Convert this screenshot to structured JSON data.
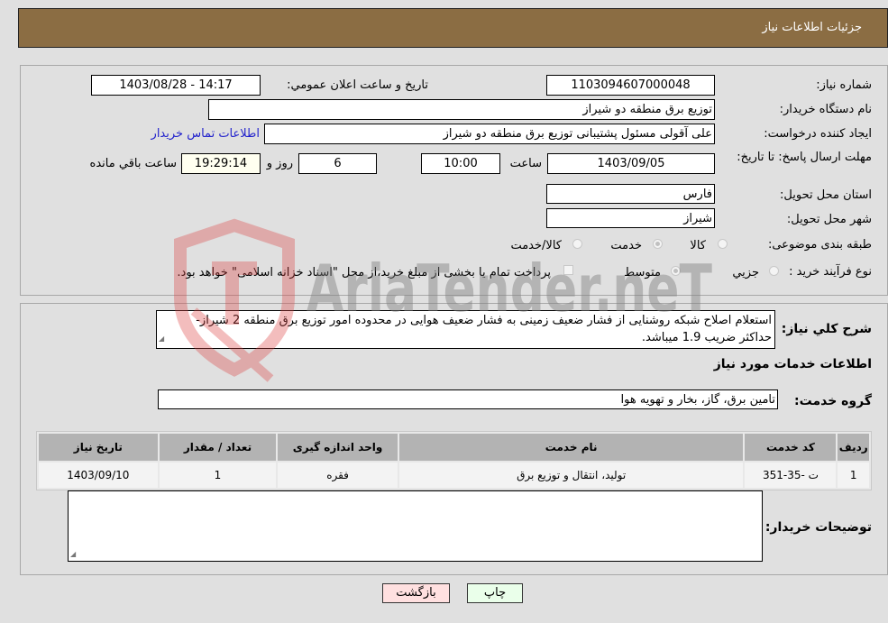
{
  "header": {
    "title": "جزئیات اطلاعات نیاز"
  },
  "fields": {
    "need_number_label": "شماره نیاز:",
    "need_number": "1103094607000048",
    "announce_label": "تاریخ و ساعت اعلان عمومي:",
    "announce_value": "1403/08/28 - 14:17",
    "buyer_org_label": "نام دستگاه خریدار:",
    "buyer_org": "توزیع برق منطقه دو شیراز",
    "creator_label": "ایجاد کننده درخواست:",
    "creator": "علی آقولی مسئول پشتیبانی  توزیع برق منطقه دو شیراز",
    "contact_link": "اطلاعات تماس خریدار",
    "deadline_label": "مهلت ارسال پاسخ: تا تاریخ:",
    "deadline_date": "1403/09/05",
    "time_label": "ساعت",
    "deadline_time": "10:00",
    "days_value": "6",
    "days_label": "روز و",
    "remaining_time": "19:29:14",
    "remaining_label": "ساعت باقي مانده",
    "province_label": "استان محل تحویل:",
    "province": "فارس",
    "city_label": "شهر محل تحویل:",
    "city": "شیراز",
    "category_label": "طبقه بندی موضوعی:",
    "category_options": [
      {
        "label": "کالا",
        "selected": false
      },
      {
        "label": "خدمت",
        "selected": true
      },
      {
        "label": "کالا/خدمت",
        "selected": false
      }
    ],
    "process_label": "نوع فرآیند خرید :",
    "process_options": [
      {
        "label": "جزيي",
        "selected": false
      },
      {
        "label": "متوسط",
        "selected": true
      }
    ],
    "treasury_note": "پرداخت تمام یا بخشی از مبلغ خرید،از محل \"اسناد خزانه اسلامی\" خواهد بود."
  },
  "description": {
    "label": "شرح كلي نياز:",
    "text": "استعلام اصلاح شبکه روشنایی از فشار ضعیف زمینی به فشار ضعیف هوایی در محدوده امور توزیع برق منطقه 2 شیراز- حداکثر ضریب 1.9 میباشد."
  },
  "services": {
    "section_title": "اطلاعات خدمات مورد نیاز",
    "group_label": "گروه خدمت:",
    "group_value": "تامین برق، گاز، بخار و تهویه هوا",
    "columns": [
      "ردیف",
      "کد خدمت",
      "نام خدمت",
      "واحد اندازه گیری",
      "تعداد / مقدار",
      "تاریخ نیاز"
    ],
    "rows": [
      [
        "1",
        "ت -35-351",
        "تولید، انتقال و توزیع برق",
        "فقره",
        "1",
        "1403/09/10"
      ]
    ]
  },
  "buyer_notes": {
    "label": "توضیحات خریدار:",
    "value": ""
  },
  "buttons": {
    "print": "چاپ",
    "back": "بازگشت"
  },
  "watermark": {
    "text": "AriaTender.neT"
  }
}
